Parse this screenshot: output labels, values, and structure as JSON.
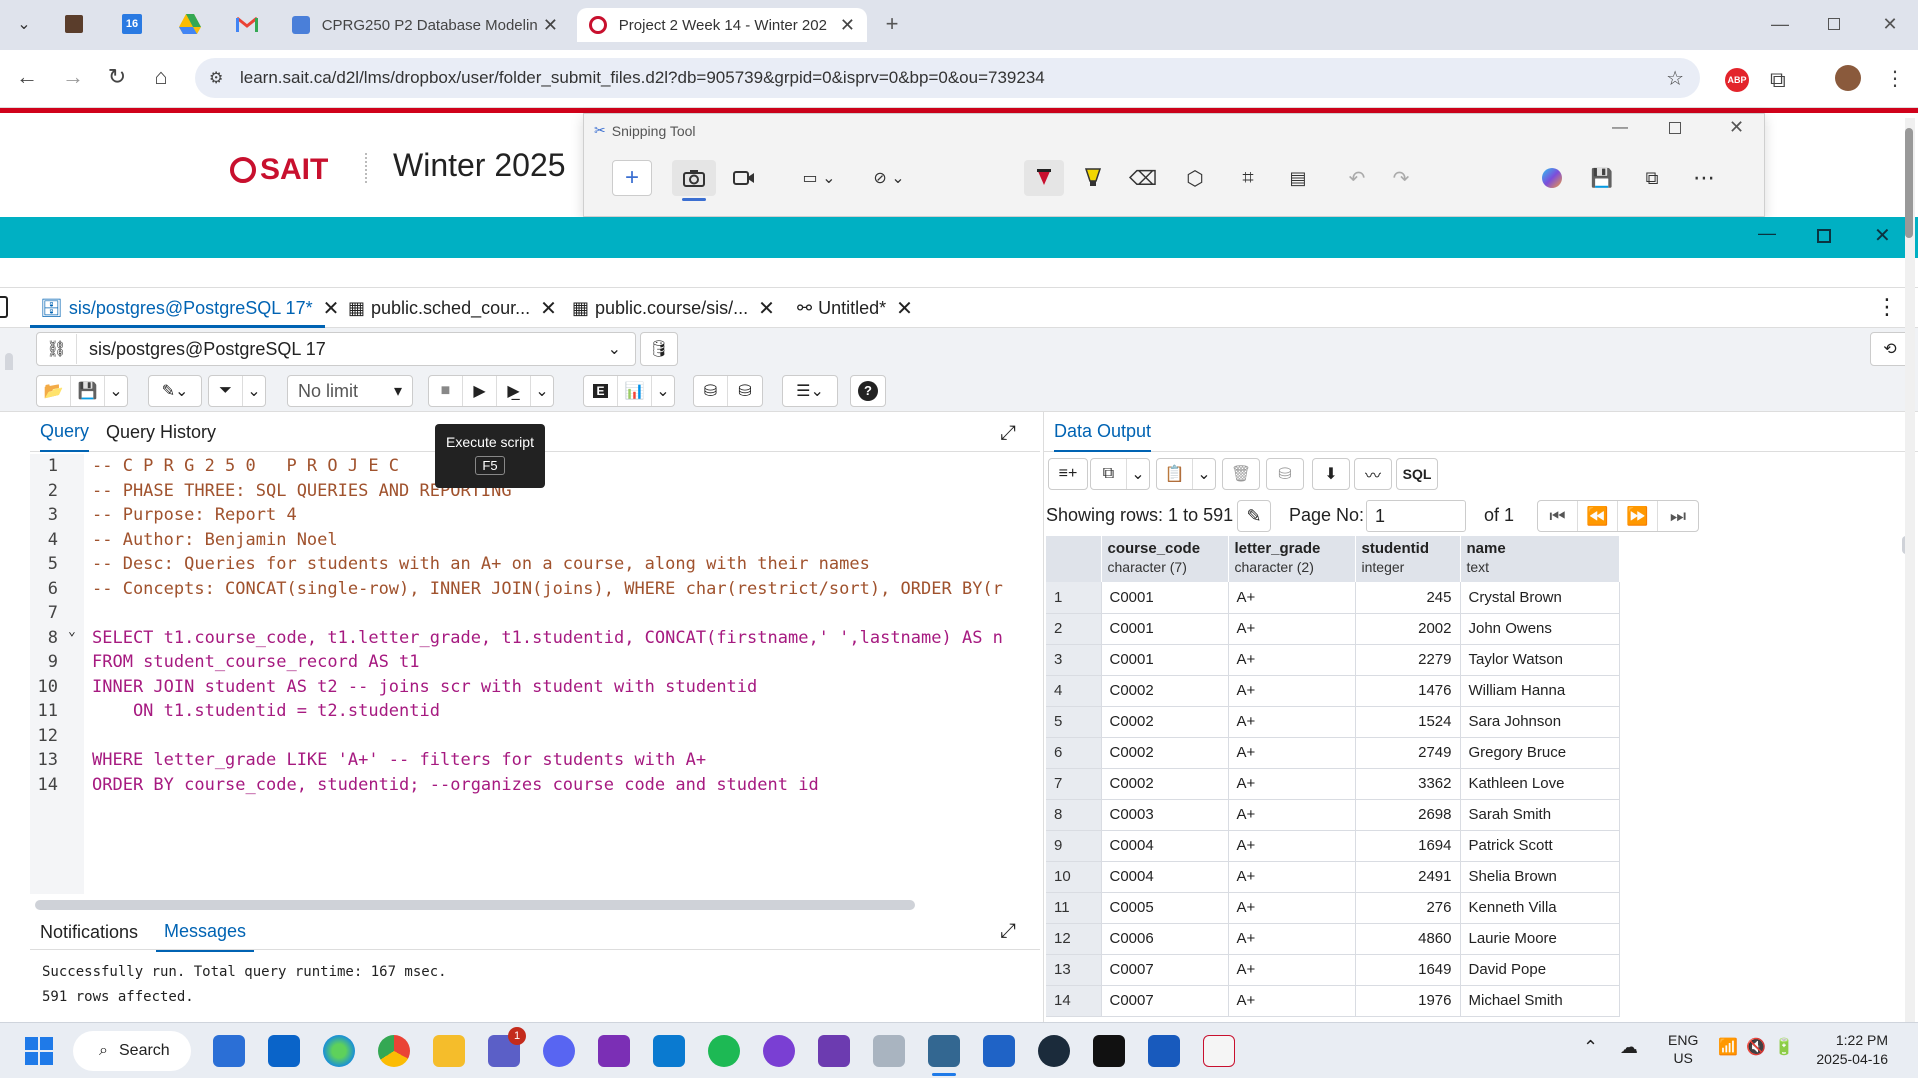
{
  "browser": {
    "tabs": [
      {
        "title": "CPRG250 P2 Database Modelin",
        "active": false
      },
      {
        "title": "Project 2 Week 14 - Winter 202",
        "active": true
      }
    ],
    "url": "learn.sait.ca/d2l/lms/dropbox/user/folder_submit_files.d2l?db=905739&grpid=0&isprv=0&bp=0&ou=739234",
    "abp_label": "ABP"
  },
  "site": {
    "logo_text": "SAIT",
    "term": "Winter 2025"
  },
  "snipping_tool": {
    "title": "Snipping Tool"
  },
  "pgadmin": {
    "tabs": [
      {
        "label": "sis/postgres@PostgreSQL 17*",
        "active": true
      },
      {
        "label": "public.sched_cour...",
        "active": false
      },
      {
        "label": "public.course/sis/...",
        "active": false
      },
      {
        "label": "Untitled*",
        "active": false
      }
    ],
    "connection": "sis/postgres@PostgreSQL 17",
    "limit": "No limit",
    "query_tabs": [
      "Query",
      "Query History"
    ],
    "tooltip": {
      "title": "Execute script",
      "key": "F5"
    },
    "code_lines": [
      "-- C P R G 2 5 0   P R O J E C",
      "-- PHASE THREE: SQL QUERIES AND REPORTING",
      "-- Purpose: Report 4",
      "-- Author: Benjamin Noel",
      "-- Desc: Queries for students with an A+ on a course, along with their names",
      "-- Concepts: CONCAT(single-row), INNER JOIN(joins), WHERE char(restrict/sort), ORDER BY(r",
      "",
      "SELECT t1.course_code, t1.letter_grade, t1.studentid, CONCAT(firstname,' ',lastname) AS n",
      "FROM student_course_record AS t1",
      "INNER JOIN student AS t2 -- joins scr with student with studentid",
      "    ON t1.studentid = t2.studentid",
      "",
      "WHERE letter_grade LIKE 'A+' -- filters for students with A+",
      "ORDER BY course_code, studentid; --organizes course code and student id"
    ],
    "msg_tabs": [
      "Notifications",
      "Messages"
    ],
    "messages": [
      "Successfully run. Total query runtime: 167 msec.",
      "591 rows affected."
    ],
    "data_output": {
      "tab_label": "Data Output",
      "sql_label": "SQL",
      "showing": "Showing rows: 1 to 591",
      "page_no_label": "Page No:",
      "page_no": "1",
      "of_pages": "of 1",
      "columns": [
        {
          "name": "course_code",
          "type": "character (7)"
        },
        {
          "name": "letter_grade",
          "type": "character (2)"
        },
        {
          "name": "studentid",
          "type": "integer"
        },
        {
          "name": "name",
          "type": "text"
        }
      ],
      "rows": [
        [
          "1",
          "C0001",
          "A+",
          "245",
          "Crystal Brown"
        ],
        [
          "2",
          "C0001",
          "A+",
          "2002",
          "John Owens"
        ],
        [
          "3",
          "C0001",
          "A+",
          "2279",
          "Taylor Watson"
        ],
        [
          "4",
          "C0002",
          "A+",
          "1476",
          "William Hanna"
        ],
        [
          "5",
          "C0002",
          "A+",
          "1524",
          "Sara Johnson"
        ],
        [
          "6",
          "C0002",
          "A+",
          "2749",
          "Gregory Bruce"
        ],
        [
          "7",
          "C0002",
          "A+",
          "3362",
          "Kathleen Love"
        ],
        [
          "8",
          "C0003",
          "A+",
          "2698",
          "Sarah Smith"
        ],
        [
          "9",
          "C0004",
          "A+",
          "1694",
          "Patrick Scott"
        ],
        [
          "10",
          "C0004",
          "A+",
          "2491",
          "Shelia Brown"
        ],
        [
          "11",
          "C0005",
          "A+",
          "276",
          "Kenneth Villa"
        ],
        [
          "12",
          "C0006",
          "A+",
          "4860",
          "Laurie Moore"
        ],
        [
          "13",
          "C0007",
          "A+",
          "1649",
          "David Pope"
        ],
        [
          "14",
          "C0007",
          "A+",
          "1976",
          "Michael Smith"
        ]
      ]
    }
  },
  "taskbar": {
    "search_label": "Search",
    "teams_badge": "1",
    "lang_top": "ENG",
    "lang_bottom": "US",
    "time": "1:22 PM",
    "date": "2025-04-16"
  }
}
